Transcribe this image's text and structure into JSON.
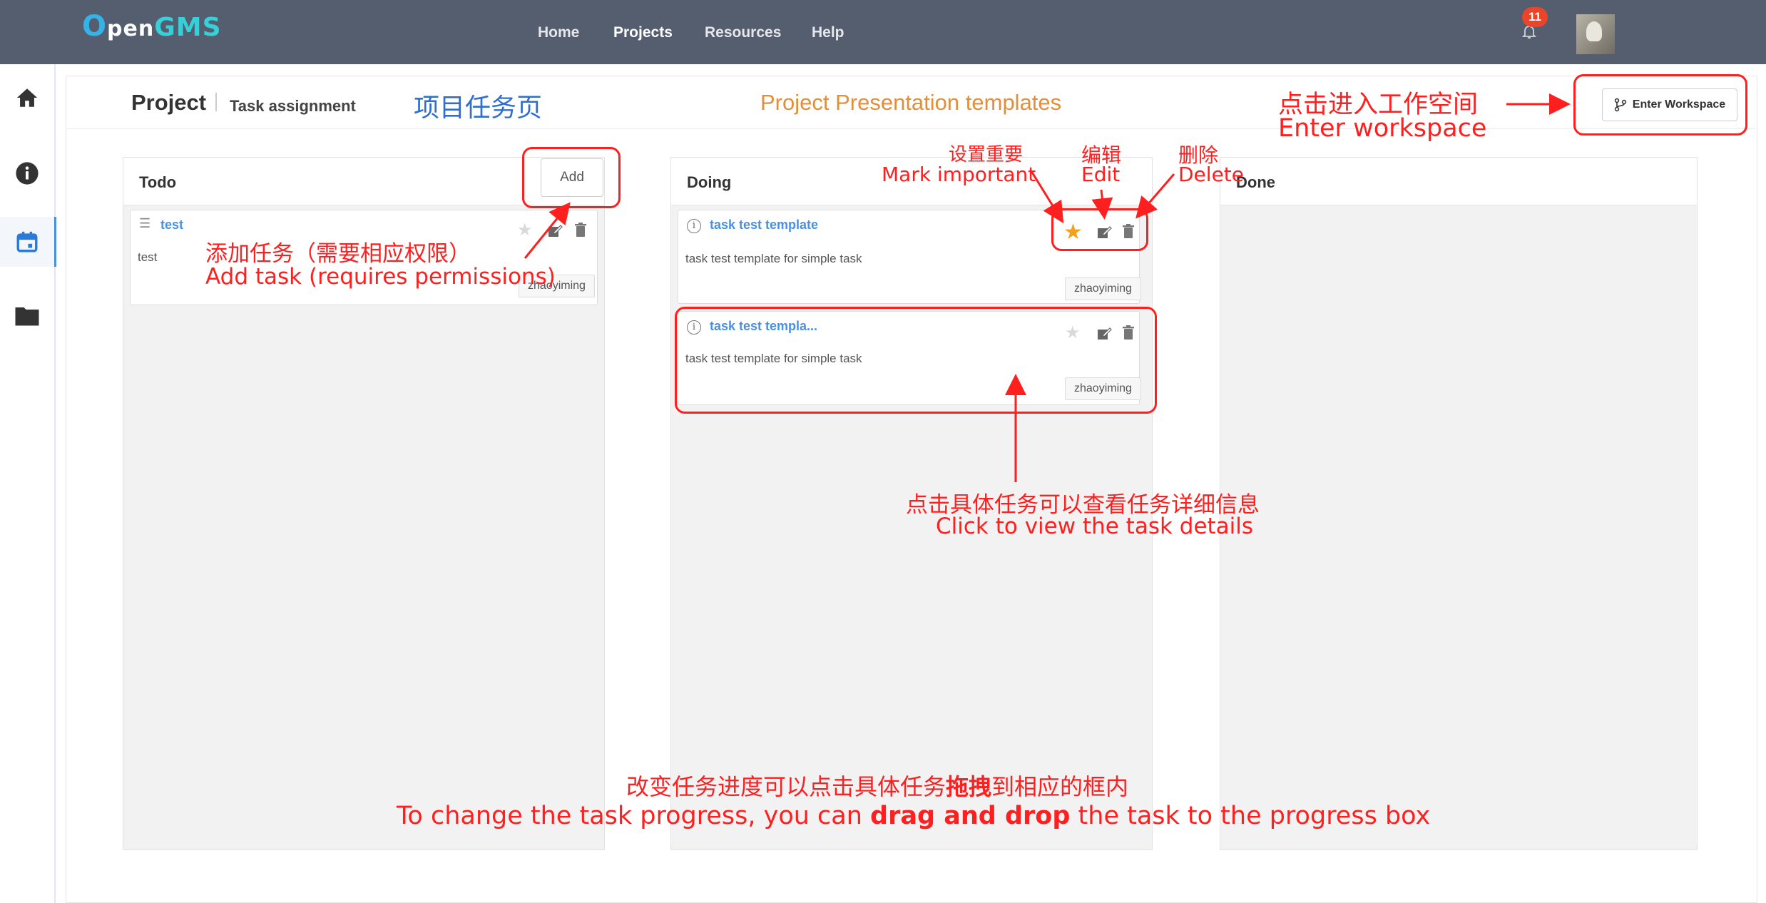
{
  "navbar": {
    "logo_o": "O",
    "logo_pen": "pen",
    "logo_gms": "GMS",
    "items": [
      {
        "label": "Home"
      },
      {
        "label": "Projects"
      },
      {
        "label": "Resources"
      },
      {
        "label": "Help"
      }
    ],
    "active_item": "Projects",
    "notification_count": "11"
  },
  "sidebar": {
    "items": [
      {
        "icon": "home-icon"
      },
      {
        "icon": "info-icon"
      },
      {
        "icon": "calendar-icon",
        "active": true
      },
      {
        "icon": "folder-icon"
      }
    ]
  },
  "page_header": {
    "project": "Project",
    "subtitle": "Task assignment",
    "title": "Project Presentation templates",
    "enter_workspace": "Enter Workspace"
  },
  "columns": {
    "todo": {
      "title": "Todo",
      "add_label": "Add",
      "cards": [
        {
          "title": "test",
          "description": "test",
          "user": "zhaoyiming"
        }
      ]
    },
    "doing": {
      "title": "Doing",
      "cards": [
        {
          "title": "task test template",
          "description": "task test template for simple task",
          "user": "zhaoyiming",
          "important": true
        },
        {
          "title": "task test templa...",
          "description": "task test template for simple task",
          "user": "zhaoyiming",
          "important": false
        }
      ]
    },
    "done": {
      "title": "Done",
      "cards": []
    }
  },
  "annotations": {
    "page_label_cn": "项目任务页",
    "enter_cn": "点击进入工作空间",
    "enter_en": "Enter workspace",
    "mark_cn": "设置重要",
    "mark_en": "Mark important",
    "edit_cn": "编辑",
    "edit_en": "Edit",
    "delete_cn": "删除",
    "delete_en": "Delete",
    "add_cn": "添加任务（需要相应权限）",
    "add_en": "Add task (requires permissions)",
    "click_cn": "点击具体任务可以查看任务详细信息",
    "click_en": "Click to view the task details",
    "drag_cn_1": "改变任务进度可以点击具体任务",
    "drag_cn_bold": "拖拽",
    "drag_cn_2": "到相应的框内",
    "drag_en_1": "To change the task progress, you can ",
    "drag_en_bold": "drag and drop",
    "drag_en_2": " the task to the  progress box"
  },
  "colors": {
    "navbar": "#555e6f",
    "accent": "#4a90e2",
    "title_orange": "#e28f3c",
    "annotation_red": "#ff1f1f",
    "annotation_blue": "#2f6fd0",
    "star_active": "#f0a11e"
  }
}
